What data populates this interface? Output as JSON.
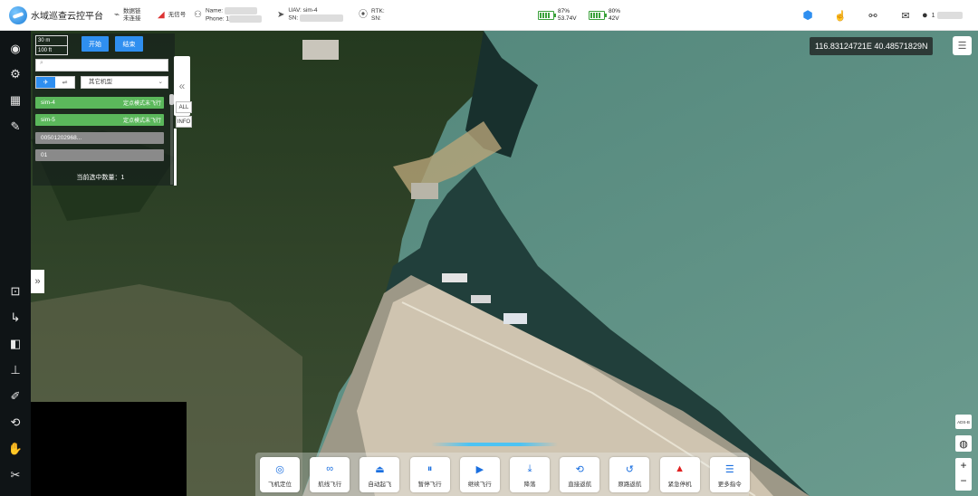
{
  "header": {
    "app_title": "水域巡查云控平台",
    "data_link": {
      "label": "数据链",
      "value": "未连接"
    },
    "signal": {
      "label": "无信号"
    },
    "operator": {
      "name_label": "Name:",
      "phone_label": "Phone:",
      "phone_prefix": "1"
    },
    "uav": {
      "label": "UAV:",
      "value": "sim-4",
      "sn_label": "SN:"
    },
    "rtk": {
      "label": "RTK:",
      "sn_label": "SN:"
    },
    "battery1": {
      "percent": "87%",
      "voltage": "53.74V",
      "level": 0.87
    },
    "battery2": {
      "percent": "80%",
      "voltage": "42V",
      "level": 0.8
    },
    "user_prefix": "1"
  },
  "panel": {
    "scale_a": "30 m",
    "scale_b": "100 ft",
    "start_label": "开始",
    "end_label": "结束",
    "search_placeholder": "",
    "type_select": "其它机型",
    "uavs": [
      {
        "name": "sim-4",
        "status": "定点模式未飞行",
        "color": "#5bb85b"
      },
      {
        "name": "sim-5",
        "status": "定点模式未飞行",
        "color": "#5bb85b"
      },
      {
        "name": "00501202968...",
        "status": "",
        "color": "#8a8a8a"
      },
      {
        "name": "01",
        "status": "",
        "color": "#8a8a8a"
      }
    ],
    "count_label": "当前选中数量：1",
    "tab_all": "ALL",
    "tab_info": "INFO"
  },
  "map": {
    "coords": "116.83124721E 40.48571829N",
    "adsb_label": "ADS-B",
    "zoom_in": "+",
    "zoom_out": "−"
  },
  "toolbar": [
    {
      "label": "飞机定位",
      "icon": "target-icon"
    },
    {
      "label": "航线飞行",
      "icon": "route-icon"
    },
    {
      "label": "自动起飞",
      "icon": "takeoff-icon"
    },
    {
      "label": "暂停飞行",
      "icon": "pause-icon"
    },
    {
      "label": "继续飞行",
      "icon": "play-icon"
    },
    {
      "label": "降落",
      "icon": "land-icon"
    },
    {
      "label": "直接返航",
      "icon": "return-icon"
    },
    {
      "label": "原路返航",
      "icon": "trace-back-icon"
    },
    {
      "label": "紧急停机",
      "icon": "warning-icon",
      "color": "#e02020"
    },
    {
      "label": "更多指令",
      "icon": "list-icon"
    }
  ]
}
